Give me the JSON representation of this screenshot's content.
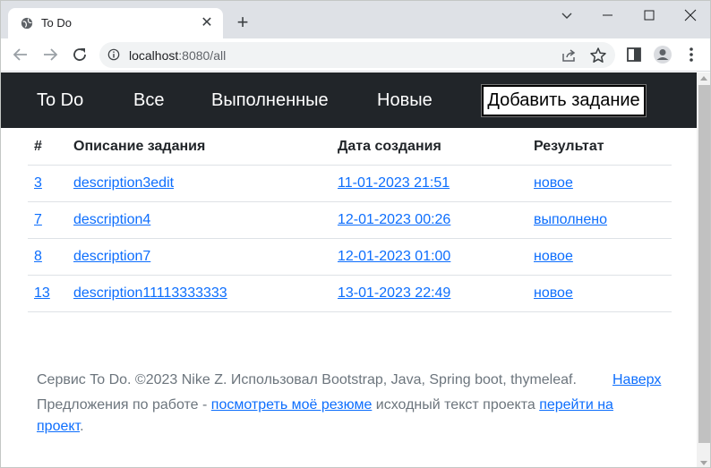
{
  "browser": {
    "tab_title": "To Do",
    "url_host": "localhost",
    "url_path": ":8080/all"
  },
  "navbar": {
    "brand": "To Do",
    "links": [
      "Все",
      "Выполненные",
      "Новые"
    ],
    "add_button": "Добавить задание"
  },
  "table": {
    "headers": [
      "#",
      "Описание задания",
      "Дата создания",
      "Результат"
    ],
    "rows": [
      {
        "id": "3",
        "description": "description3edit",
        "created": "11-01-2023 21:51",
        "status": "новое"
      },
      {
        "id": "7",
        "description": "description4",
        "created": "12-01-2023 00:26",
        "status": "выполнено"
      },
      {
        "id": "8",
        "description": "description7",
        "created": "12-01-2023 01:00",
        "status": "новое"
      },
      {
        "id": "13",
        "description": "description11113333333",
        "created": "13-01-2023 22:49",
        "status": "новое"
      }
    ]
  },
  "footer": {
    "copyright": "Сервис To Do. ©2023 Nike Z. Использовал Bootstrap, Java, Spring boot, thymeleaf.",
    "top_link": "Наверх",
    "offers_prefix": "Предложения по работе - ",
    "resume_link": "посмотреть моё резюме",
    "source_text": " исходный текст проекта ",
    "project_link": "перейти на проект",
    "end": "."
  }
}
